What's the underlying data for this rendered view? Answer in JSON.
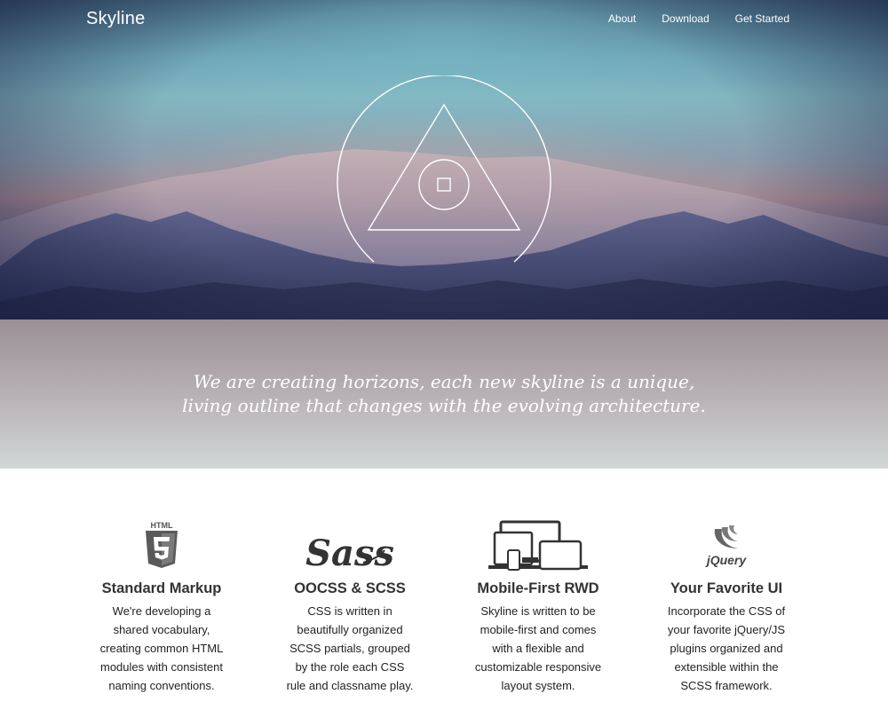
{
  "brand": "Skyline",
  "nav": {
    "items": [
      {
        "label": "About"
      },
      {
        "label": "Download"
      },
      {
        "label": "Get Started"
      }
    ]
  },
  "tagline": {
    "line1": "We are creating horizons, each new skyline is a unique,",
    "line2": "living outline that changes with the evolving architecture."
  },
  "features": [
    {
      "icon": "html5-icon",
      "icon_text": "HTML",
      "title": "Standard Markup",
      "lines": [
        "We're developing a",
        "shared vocabulary,",
        "creating common HTML",
        "modules with consistent",
        "naming conventions."
      ]
    },
    {
      "icon": "sass-icon",
      "icon_text": "Sass",
      "title": "OOCSS & SCSS",
      "lines": [
        "CSS is written in",
        "beautifully organized",
        "SCSS partials, grouped",
        "by the role each CSS",
        "rule and classname play."
      ]
    },
    {
      "icon": "devices-icon",
      "title": "Mobile-First RWD",
      "lines": [
        "Skyline is written to be",
        "mobile-first and comes",
        "with a flexible and",
        "customizable responsive",
        "layout system."
      ]
    },
    {
      "icon": "jquery-icon",
      "icon_text": "jQuery",
      "title": "Your Favorite UI",
      "lines": [
        "Incorporate the CSS of",
        "your favorite jQuery/JS",
        "plugins organized and",
        "extensible within the",
        "SCSS framework."
      ]
    }
  ],
  "colors": {
    "hero_top": "#3c5a73",
    "hero_sky": "#82b3bd",
    "hero_bottom": "#2c3458",
    "tagline_top": "#9a8f95",
    "tagline_bottom": "#d2d7d6",
    "icon_gray": "#555555",
    "text_dark": "#333333"
  }
}
